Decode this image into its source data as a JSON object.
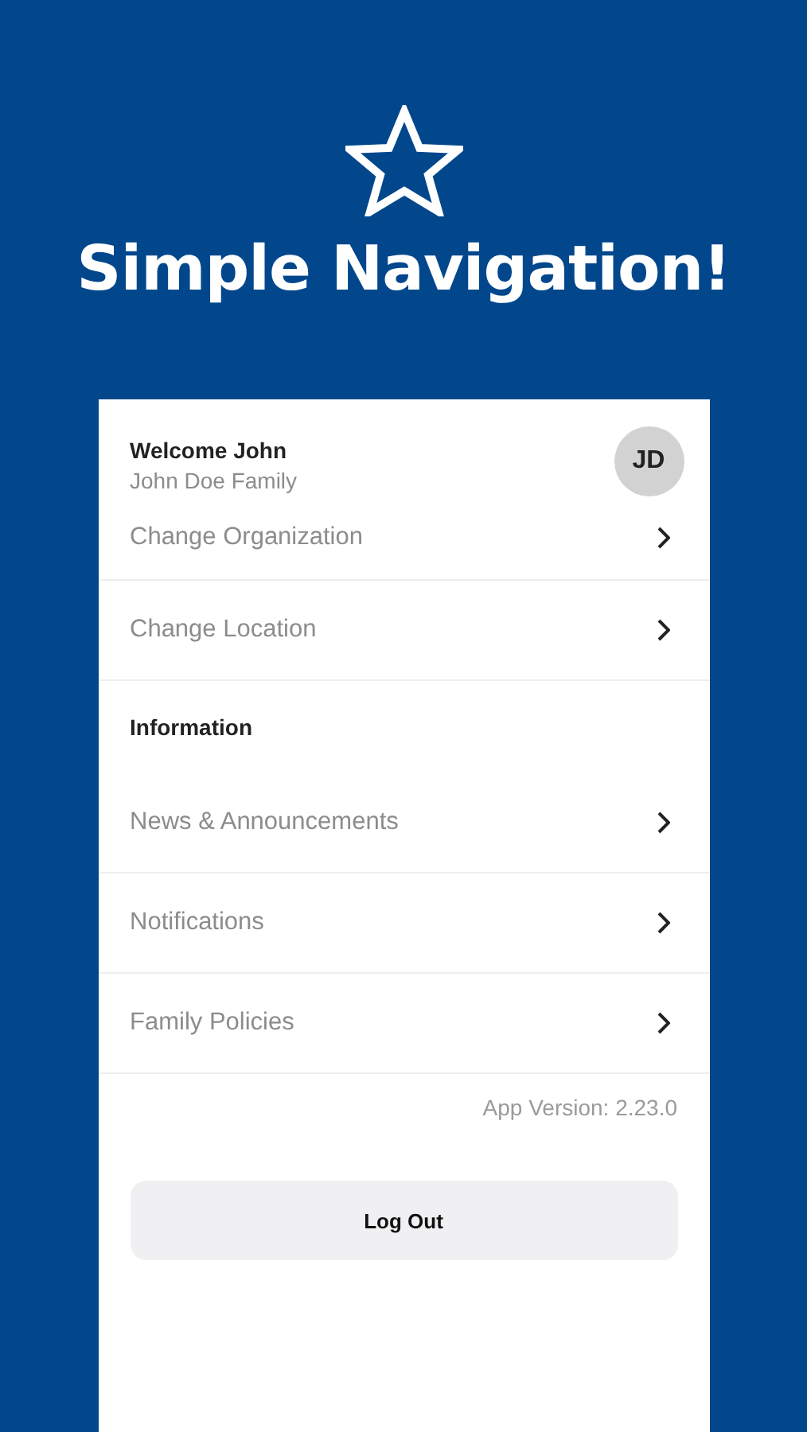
{
  "hero": {
    "title": "Simple Navigation!"
  },
  "profile": {
    "greeting": "Welcome John",
    "family": "John Doe Family",
    "initials": "JD"
  },
  "menu": [
    {
      "kind": "link",
      "label": "Change Organization"
    },
    {
      "kind": "link",
      "label": "Change Location"
    },
    {
      "kind": "heading",
      "label": "Information"
    },
    {
      "kind": "link",
      "label": "News & Announcements"
    },
    {
      "kind": "link",
      "label": "Notifications"
    },
    {
      "kind": "link",
      "label": "Family Policies"
    }
  ],
  "app_version": "App Version: 2.23.0",
  "logout_button": "Log Out"
}
